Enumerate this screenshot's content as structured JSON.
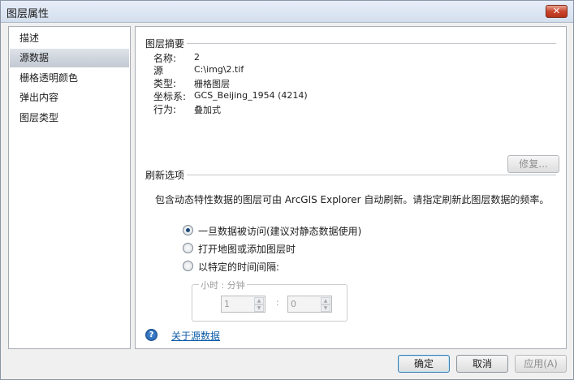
{
  "window": {
    "title": "图层属性",
    "close_symbol": "✕"
  },
  "sidebar": {
    "items": [
      {
        "label": "描述",
        "selected": false
      },
      {
        "label": "源数据",
        "selected": true
      },
      {
        "label": "栅格透明颜色",
        "selected": false
      },
      {
        "label": "弹出内容",
        "selected": false
      },
      {
        "label": "图层类型",
        "selected": false
      }
    ]
  },
  "summary": {
    "title": "图层摘要",
    "rows": [
      {
        "label": "名称:",
        "value": "2"
      },
      {
        "label": "源",
        "value": "C:\\img\\2.tif"
      },
      {
        "label": "类型:",
        "value": "栅格图层"
      },
      {
        "label": "坐标系:",
        "value": "GCS_Beijing_1954 (4214)"
      },
      {
        "label": "行为:",
        "value": "叠加式"
      }
    ],
    "repair_button": "修复..."
  },
  "refresh": {
    "title": "刷新选项",
    "description": "包含动态特性数据的图层可由 ArcGIS Explorer 自动刷新。请指定刷新此图层数据的频率。",
    "options": [
      {
        "label": "一旦数据被访问(建议对静态数据使用)",
        "checked": true
      },
      {
        "label": "打开地图或添加图层时",
        "checked": false
      },
      {
        "label": "以特定的时间间隔:",
        "checked": false
      }
    ],
    "interval": {
      "legend": "小时 : 分钟",
      "hours": "1",
      "minutes": "0",
      "separator": ":"
    }
  },
  "help": {
    "icon": "help-icon",
    "icon_glyph": "?",
    "link": "关于源数据"
  },
  "footer": {
    "ok": "确定",
    "cancel": "取消",
    "apply": "应用(A)"
  }
}
